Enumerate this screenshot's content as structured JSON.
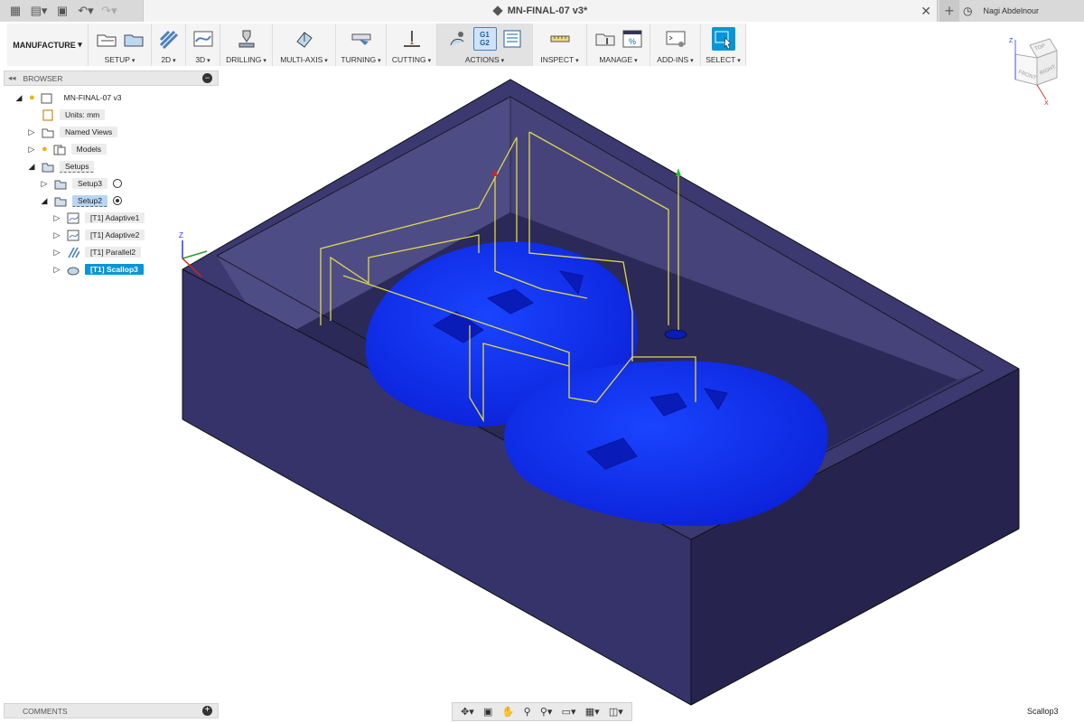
{
  "window": {
    "title": "MN-FINAL-07 v3*",
    "user_name": "Nagi Abdelnour"
  },
  "toolbar": {
    "workspace_label": "MANUFACTURE",
    "groups": [
      "SETUP",
      "2D",
      "3D",
      "DRILLING",
      "MULTI-AXIS",
      "TURNING",
      "CUTTING",
      "ACTIONS",
      "INSPECT",
      "MANAGE",
      "ADD-INS",
      "SELECT"
    ],
    "actions_g1": "G1",
    "actions_g2": "G2"
  },
  "browser": {
    "header": "BROWSER",
    "root": "MN-FINAL-07 v3",
    "units": "Units: mm",
    "named_views": "Named Views",
    "models": "Models",
    "setups": "Setups",
    "setup3": "Setup3",
    "setup2": "Setup2",
    "ops": [
      "[T1] Adaptive1",
      "[T1] Adaptive2",
      "[T1] Parallel2",
      "[T1] Scallop3"
    ]
  },
  "comments": {
    "header": "COMMENTS"
  },
  "status": {
    "selected_name": "Scallop3"
  },
  "viewcube": {
    "top": "TOP",
    "front": "FRONT",
    "right": "RIGHT",
    "z": "Z",
    "x": "X"
  },
  "triad": {
    "z": "Z",
    "x": "X"
  },
  "colors": {
    "accent": "#0696d7",
    "stock": "#2e2c63",
    "part": "#0f2fff",
    "toolpath": "#e2d84a"
  }
}
